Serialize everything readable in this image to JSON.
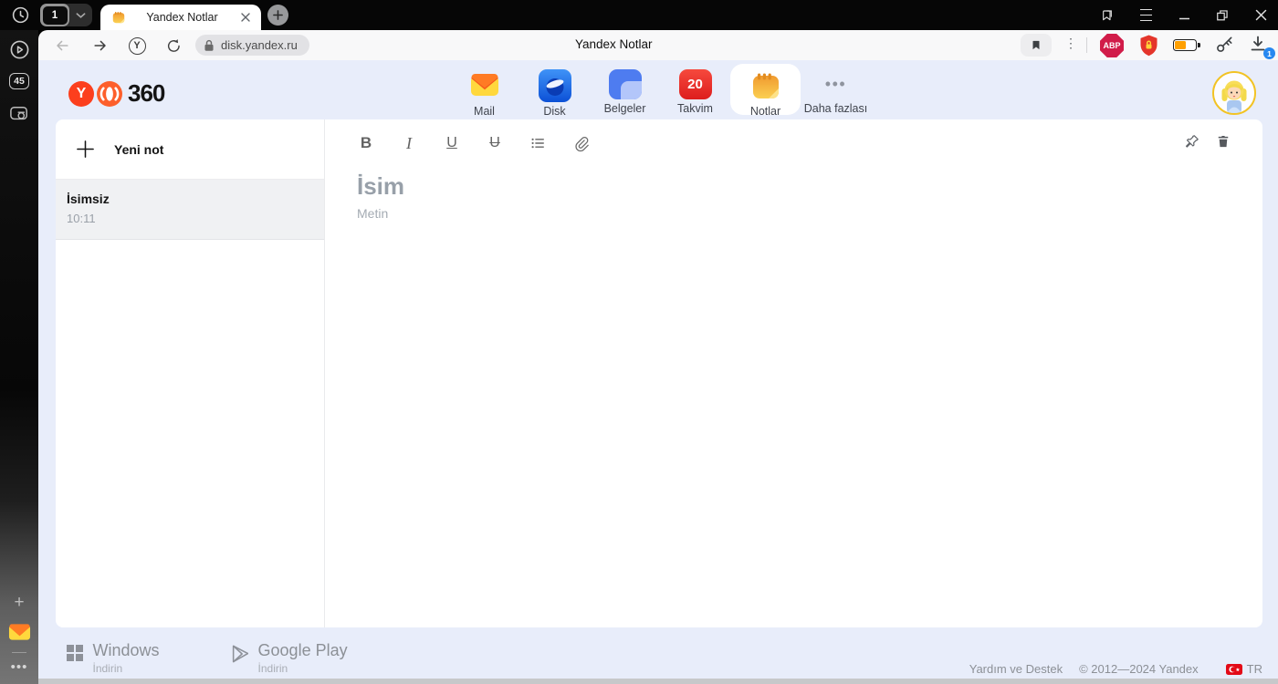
{
  "titlebar": {
    "tab_count_badge": "1",
    "tab_title": "Yandex Notlar"
  },
  "toolbar": {
    "url": "disk.yandex.ru",
    "page_title": "Yandex Notlar",
    "abp_badge": "ABP",
    "download_badge": "1"
  },
  "sidebar": {
    "tab_counter": "45"
  },
  "header": {
    "logo_text": "360",
    "apps": [
      {
        "label": "Mail"
      },
      {
        "label": "Disk"
      },
      {
        "label": "Belgeler"
      },
      {
        "label": "Takvim",
        "badge": "20"
      },
      {
        "label": "Notlar",
        "active": true
      },
      {
        "label": "Daha fazlası"
      }
    ]
  },
  "notes_panel": {
    "new_note_label": "Yeni not",
    "notes": [
      {
        "title": "İsimsiz",
        "time": "10:11",
        "selected": true
      }
    ]
  },
  "editor": {
    "toolbar": {
      "bold": "B",
      "italic": "I",
      "underline": "U",
      "strikethrough": "U"
    },
    "title_placeholder": "İsim",
    "body_placeholder": "Metin"
  },
  "footer": {
    "downloads": [
      {
        "platform": "Windows",
        "action": "İndirin"
      },
      {
        "platform": "Google Play",
        "action": "İndirin"
      }
    ],
    "help_link": "Yardım ve Destek",
    "copyright": "© 2012—2024 Yandex",
    "locale": "TR"
  },
  "colors": {
    "page_background": "#e8edfa",
    "yandex_red": "#fc3f1d",
    "notes_orange": "#f5a83b",
    "calendar_red": "#ee2e24",
    "protect_shield_red": "#e4352b",
    "battery_fill_orange": "#ffa000",
    "download_badge_blue": "#2788f0",
    "abp_red": "#d11c49"
  }
}
